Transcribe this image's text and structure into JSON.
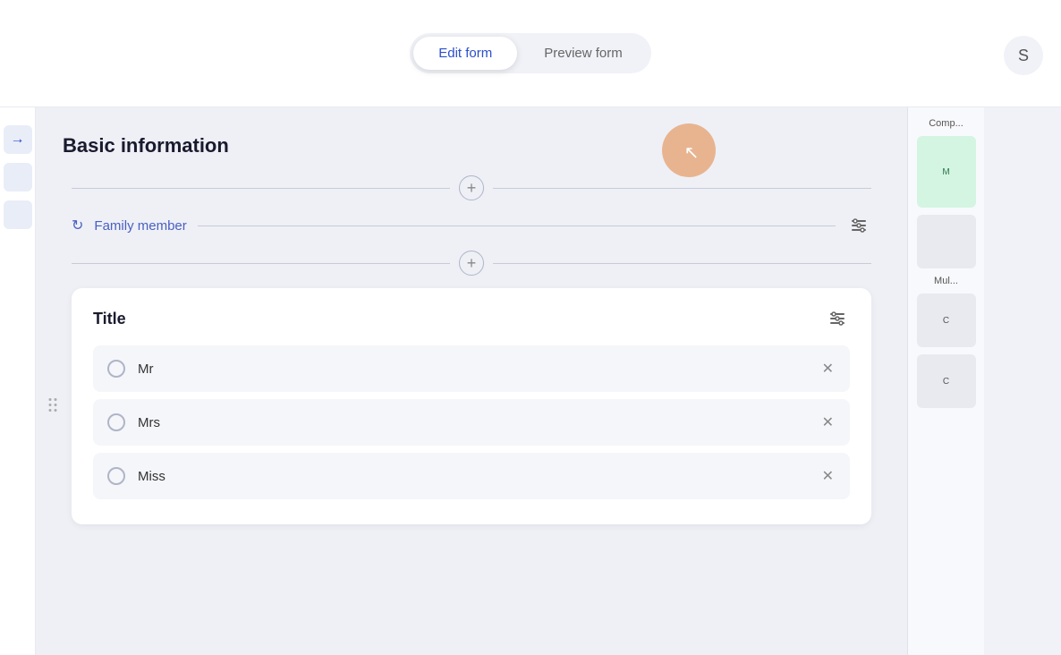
{
  "header": {
    "edit_form_label": "Edit form",
    "preview_form_label": "Preview form",
    "active_tab": "edit"
  },
  "top_right": {
    "button_label": "S"
  },
  "left_panel": {
    "arrow_label": "→"
  },
  "form": {
    "section_title": "Basic information",
    "add_item_1": "+",
    "family_member_label": "Family member",
    "add_item_2": "+",
    "title_card": {
      "title": "Title",
      "options": [
        {
          "label": "Mr",
          "id": "mr"
        },
        {
          "label": "Mrs",
          "id": "mrs"
        },
        {
          "label": "Miss",
          "id": "miss"
        }
      ]
    }
  },
  "right_sidebar": {
    "section_label": "Comp...",
    "multi_label": "Mul...",
    "component_label": "M",
    "second_label": "C",
    "third_label": "C"
  },
  "cursor": {
    "visible": true
  }
}
